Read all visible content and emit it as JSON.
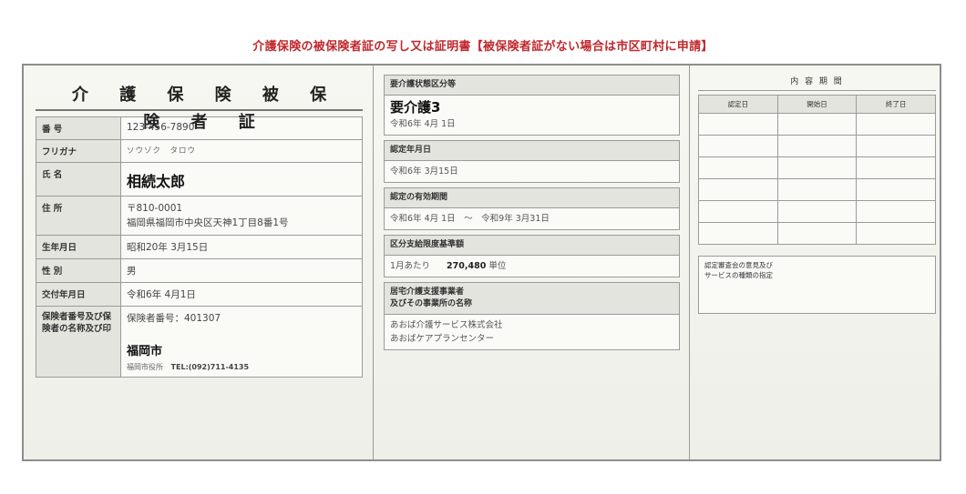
{
  "caption": "介護保険の被保険者証の写し又は証明書【被保険者証がない場合は市区町村に申請】",
  "card": {
    "title": "介 護 保 険 被 保 険 者 証",
    "rows": [
      {
        "key": "番 号",
        "value": "123-456-7890"
      },
      {
        "key": "フリガナ",
        "value": "ソウゾク　タロウ"
      },
      {
        "key": "氏 名",
        "value": "相続太郎"
      },
      {
        "key": "住 所",
        "line1": "〒810-0001",
        "line2": "福岡県福岡市中央区天神1丁目8番1号"
      },
      {
        "key": "生年月日",
        "value": "昭和20年 3月15日"
      },
      {
        "key": "性 別",
        "value": "男"
      },
      {
        "key": "交付年月日",
        "value": "令和6年 4月1日"
      },
      {
        "key": "保険者番号及び保険者の名称及び印",
        "number": "保険者番号：401307",
        "name": "福岡市",
        "office": "福岡市役所",
        "tel": "TEL:(092)711-4135"
      }
    ]
  },
  "middle": {
    "care_status": {
      "label": "要介護状態区分等",
      "level": "要介護3",
      "date": "令和6年 4月 1日"
    },
    "cert_date": {
      "label": "認定年月日",
      "value": "令和6年 3月15日"
    },
    "valid_period": {
      "label": "認定の有効期間",
      "value": "令和6年 4月 1日　～　令和9年 3月31日"
    },
    "limit": {
      "label": "区分支給限度基準額",
      "prefix": "1月あたり",
      "amount": "270,480",
      "unit": "単位"
    },
    "provider": {
      "label_line1": "居宅介護支援事業者",
      "label_line2": "及びその事業所の名称",
      "line1": "あおば介護サービス株式会社",
      "line2": "あおばケアプランセンター"
    }
  },
  "right": {
    "title": "内 容  期 間",
    "headers": [
      "認定日",
      "開始日",
      "終了日"
    ],
    "opinion_line1": "認定審査会の意見及び",
    "opinion_line2": "サービスの種類の指定"
  }
}
